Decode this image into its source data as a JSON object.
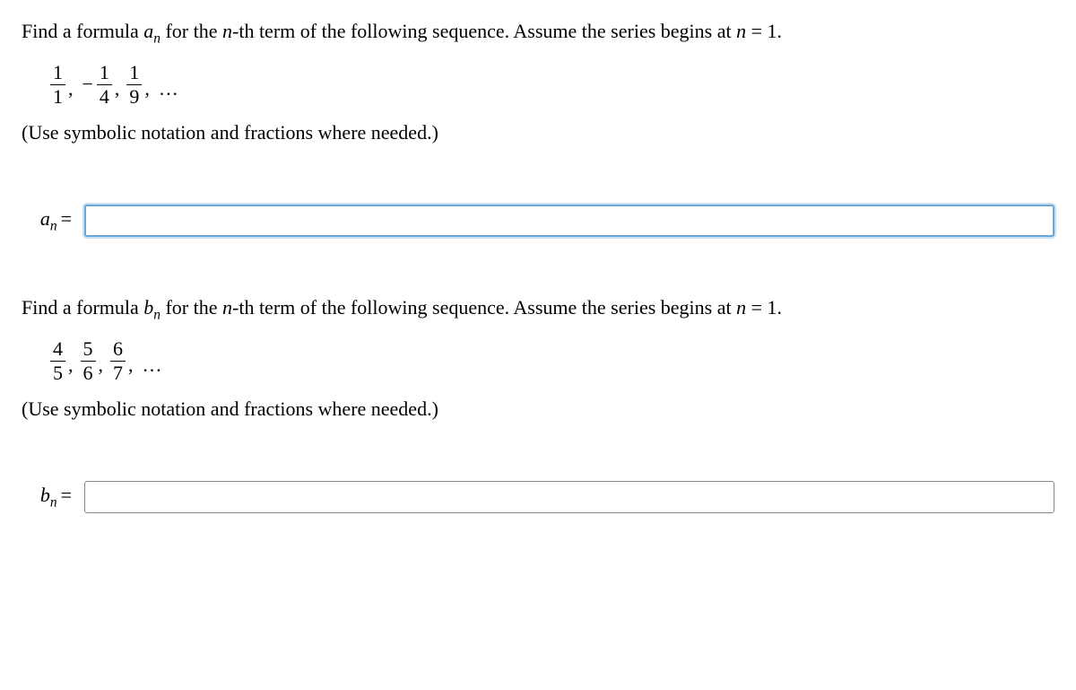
{
  "problem1": {
    "question_prefix": "Find a formula ",
    "var": "a",
    "sub": "n",
    "question_mid": " for the ",
    "nth": "n",
    "question_suffix": "-th term of the following sequence. Assume the series begins at ",
    "n_eq": "n",
    "eq_text": " = 1.",
    "seq": {
      "t1_num": "1",
      "t1_den": "1",
      "t2_num": "1",
      "t2_den": "4",
      "t3_num": "1",
      "t3_den": "9",
      "comma": ",",
      "minus": "−",
      "dots": "…"
    },
    "hint": "(Use symbolic notation and fractions where needed.)",
    "answer_label_var": "a",
    "answer_label_sub": "n",
    "answer_label_eq": "="
  },
  "problem2": {
    "question_prefix": "Find a formula ",
    "var": "b",
    "sub": "n",
    "question_mid": " for the ",
    "nth": "n",
    "question_suffix": "-th term of the following sequence. Assume the series begins at ",
    "n_eq": "n",
    "eq_text": " = 1.",
    "seq": {
      "t1_num": "4",
      "t1_den": "5",
      "t2_num": "5",
      "t2_den": "6",
      "t3_num": "6",
      "t3_den": "7",
      "comma": ",",
      "dots": "…"
    },
    "hint": "(Use symbolic notation and fractions where needed.)",
    "answer_label_var": "b",
    "answer_label_sub": "n",
    "answer_label_eq": "="
  }
}
